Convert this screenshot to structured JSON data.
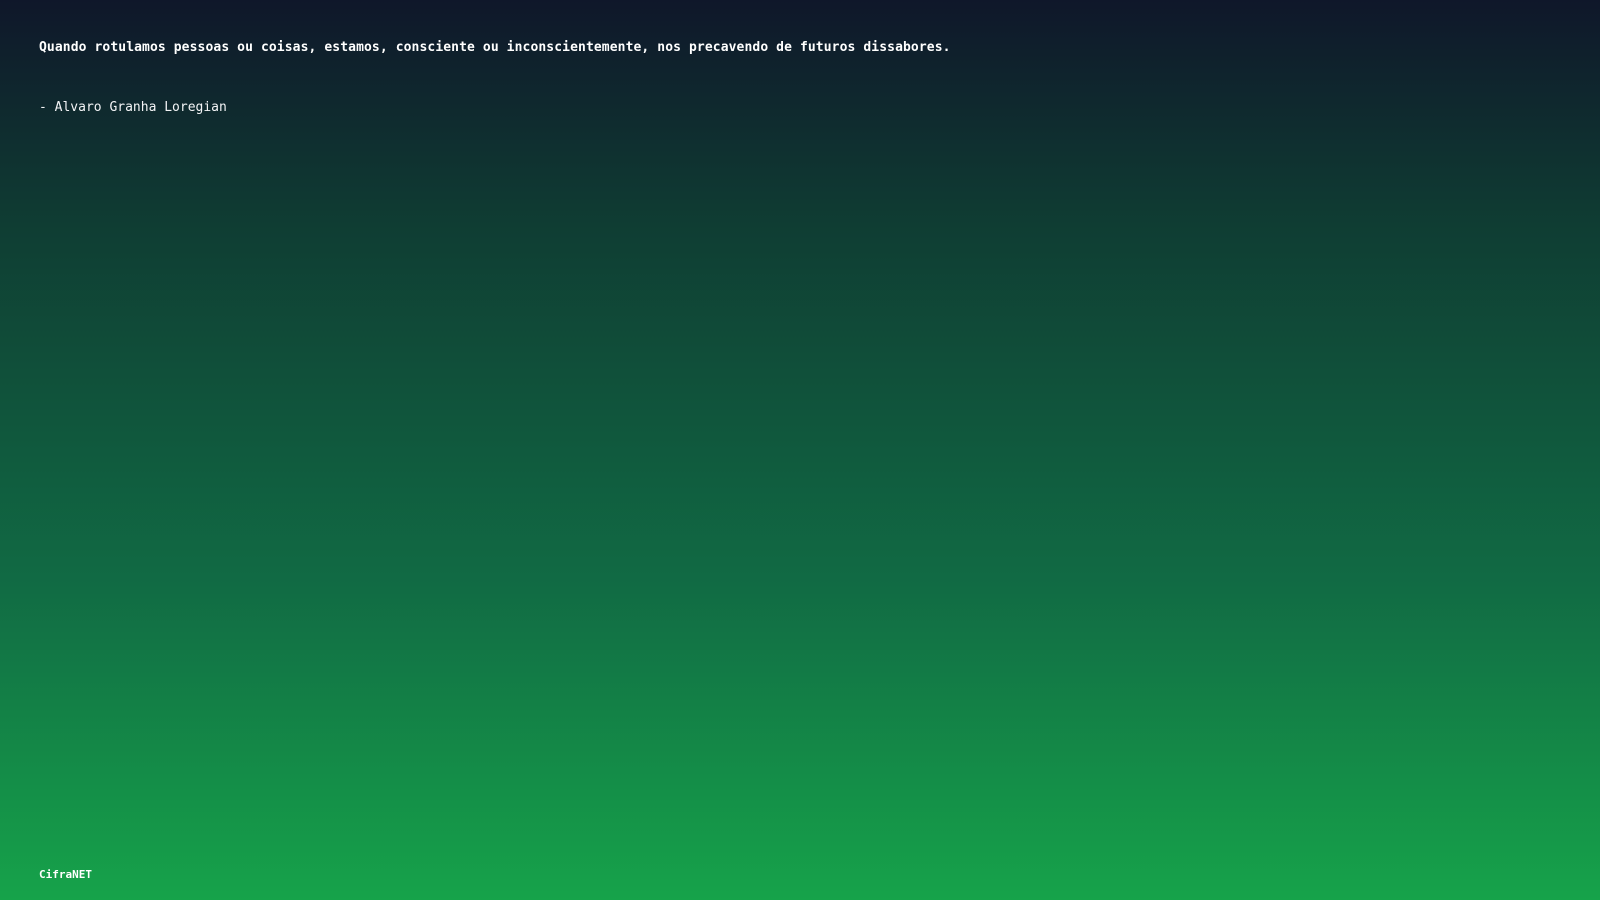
{
  "quote": {
    "text": "Quando rotulamos pessoas ou coisas, estamos, consciente ou inconscientemente, nos precavendo de futuros dissabores.",
    "author": "- Alvaro Granha Loregian"
  },
  "footer": {
    "brand": "CifraNET"
  },
  "colors": {
    "gradient_top": "#0f172a",
    "gradient_bottom": "#16a34a",
    "text": "#ffffff"
  }
}
